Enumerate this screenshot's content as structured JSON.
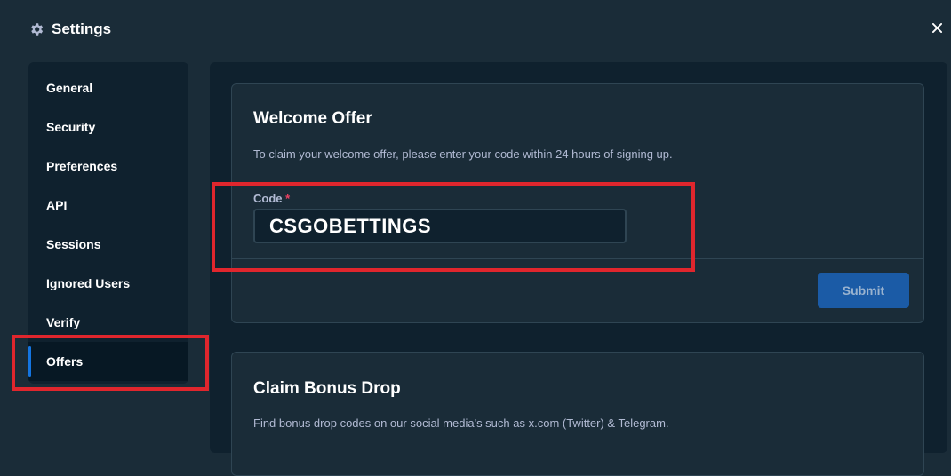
{
  "header": {
    "title": "Settings",
    "icon": "gear-icon",
    "close_icon": "close-icon"
  },
  "sidebar": {
    "items": [
      {
        "label": "General",
        "active": false
      },
      {
        "label": "Security",
        "active": false
      },
      {
        "label": "Preferences",
        "active": false
      },
      {
        "label": "API",
        "active": false
      },
      {
        "label": "Sessions",
        "active": false
      },
      {
        "label": "Ignored Users",
        "active": false
      },
      {
        "label": "Verify",
        "active": false
      },
      {
        "label": "Offers",
        "active": true
      }
    ]
  },
  "welcome_offer": {
    "title": "Welcome Offer",
    "description": "To claim your welcome offer, please enter your code within 24 hours of signing up.",
    "code_label": "Code",
    "required_mark": "*",
    "code_value": "CSGOBETTINGS",
    "submit_label": "Submit"
  },
  "bonus_drop": {
    "title": "Claim Bonus Drop",
    "description": "Find bonus drop codes on our social media's such as x.com (Twitter) & Telegram."
  },
  "colors": {
    "background": "#1a2c38",
    "panel": "#0f212e",
    "accent": "#1475e1",
    "submit": "#1b5ba6",
    "annotation": "#e0262d"
  }
}
